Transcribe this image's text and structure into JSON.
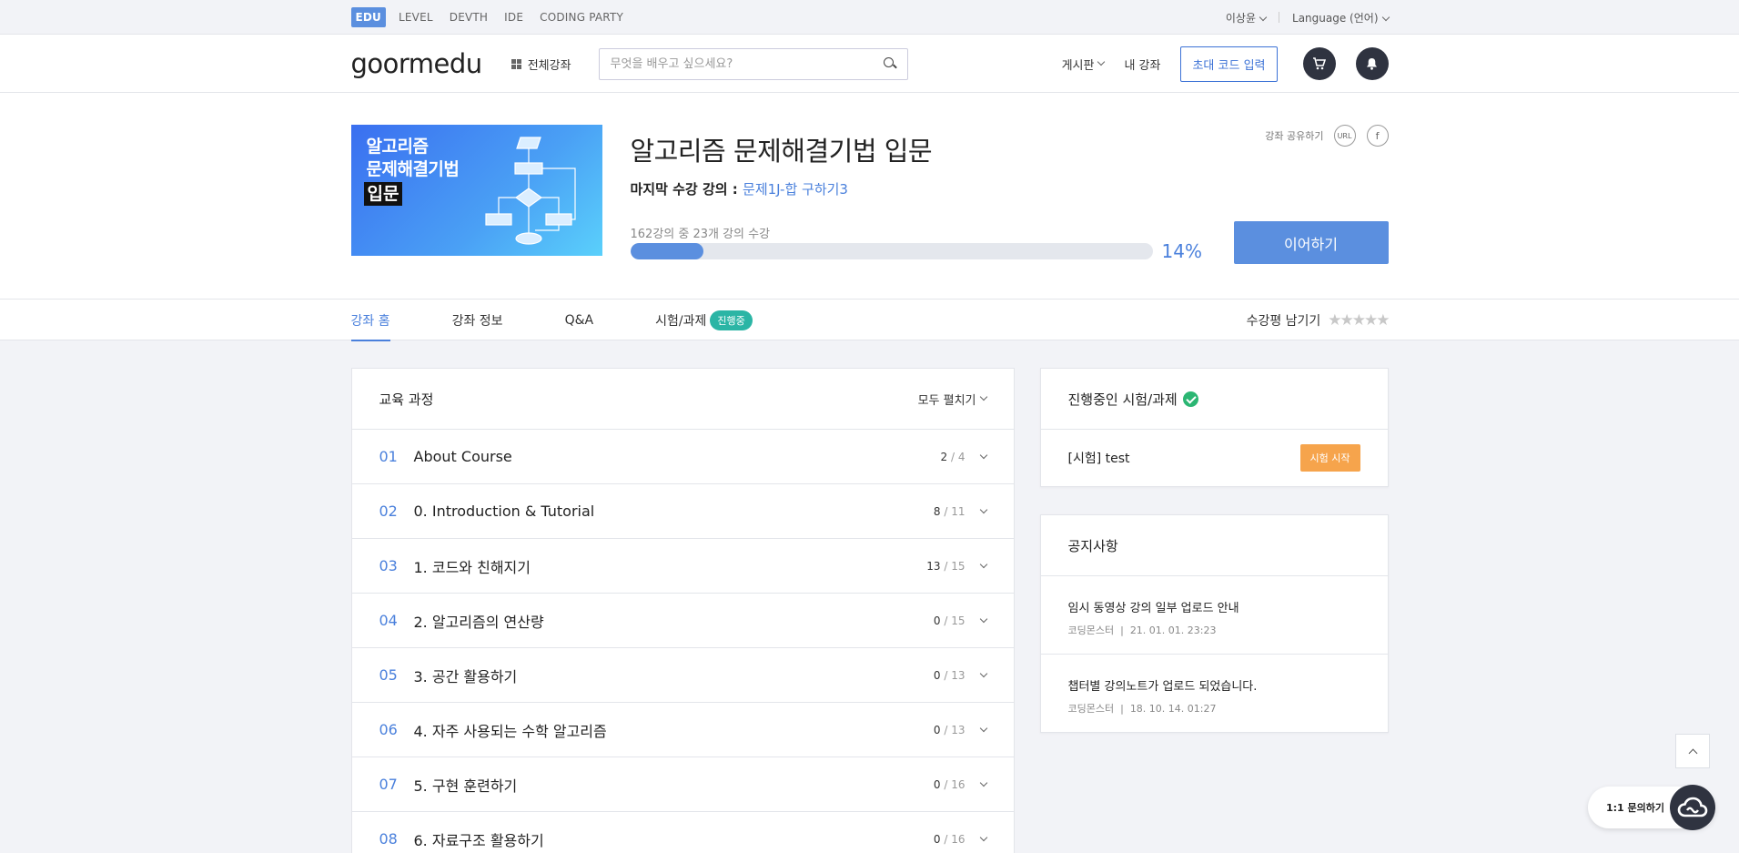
{
  "topbar": {
    "services": [
      "EDU",
      "LEVEL",
      "DEVTH",
      "IDE",
      "CODING PARTY"
    ],
    "active_service": "EDU",
    "user": "이상윤",
    "language": "Language (언어)"
  },
  "header": {
    "logo": "goormedu",
    "all_courses": "전체강좌",
    "search_placeholder": "무엇을 배우고 싶으세요?",
    "board": "게시판",
    "my_courses": "내 강좌",
    "invite_code": "초대 코드 입력"
  },
  "course": {
    "thumb_line1": "알고리즘",
    "thumb_line2": "문제해결기법",
    "thumb_line3": "입문",
    "title": "알고리즘 문제해결기법 입문",
    "last_label": "마지막 수강 강의 :",
    "last_lecture": "문제1J-합 구하기3",
    "share_label": "강좌 공유하기",
    "share_url": "URL",
    "share_fb": "f",
    "progress_text": "162강의 중 23개 강의 수강",
    "progress_percent": "14%",
    "progress_value": 0.14,
    "continue_label": "이어하기"
  },
  "tabs": {
    "items": [
      "강좌 홈",
      "강좌 정보",
      "Q&A",
      "시험/과제"
    ],
    "badge": "진행중",
    "rating_label": "수강평 남기기",
    "stars": "★★★★★"
  },
  "curriculum": {
    "title": "교육 과정",
    "expand_all": "모두 펼치기",
    "sections": [
      {
        "num": "01",
        "name": "About Course",
        "done": "2",
        "total": "/ 4"
      },
      {
        "num": "02",
        "name": "0. Introduction & Tutorial",
        "done": "8",
        "total": "/ 11"
      },
      {
        "num": "03",
        "name": "1. 코드와 친해지기",
        "done": "13",
        "total": "/ 15"
      },
      {
        "num": "04",
        "name": "2. 알고리즘의 연산량",
        "done": "0",
        "total": "/ 15"
      },
      {
        "num": "05",
        "name": "3. 공간 활용하기",
        "done": "0",
        "total": "/ 13"
      },
      {
        "num": "06",
        "name": "4. 자주 사용되는 수학 알고리즘",
        "done": "0",
        "total": "/ 13"
      },
      {
        "num": "07",
        "name": "5. 구현 훈련하기",
        "done": "0",
        "total": "/ 16"
      },
      {
        "num": "08",
        "name": "6. 자료구조 활용하기",
        "done": "0",
        "total": "/ 16"
      }
    ]
  },
  "exams": {
    "title": "진행중인 시험/과제",
    "item": "[시험] test",
    "start_label": "시험 시작"
  },
  "notices": {
    "title": "공지사항",
    "items": [
      {
        "title": "임시 동영상 강의 일부 업로드 안내",
        "author": "코딩몬스터",
        "date": "21. 01. 01. 23:23"
      },
      {
        "title": "챕터별 강의노트가 업로드 되었습니다.",
        "author": "코딩몬스터",
        "date": "18. 10. 14. 01:27"
      }
    ]
  },
  "floating": {
    "chat_label": "1:1 문의하기"
  },
  "colors": {
    "accent": "#5b8fdf",
    "badge": "#2bb5a5",
    "exam_button": "#f6a44c"
  }
}
